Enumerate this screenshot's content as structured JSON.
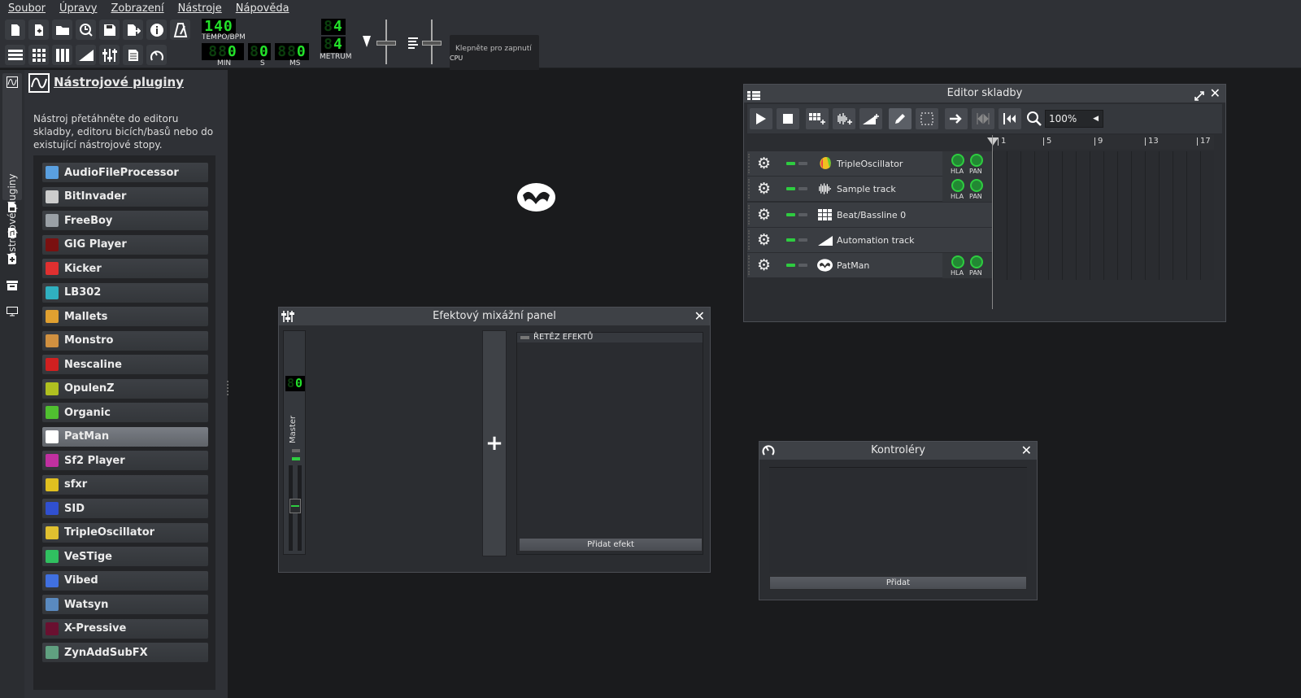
{
  "menu": [
    "Soubor",
    "Úpravy",
    "Zobrazení",
    "Nástroje",
    "Nápověda"
  ],
  "toolbar": {
    "tempo_value": "140",
    "tempo_label": "TEMPO/BPM",
    "time_min": "0",
    "time_s": "0",
    "time_ms": "0",
    "min_label": "MIN",
    "s_label": "S",
    "ms_label": "MS",
    "meter_num": "4",
    "meter_den": "4",
    "meter_label": "METRUM",
    "cpu_hint": "Klepněte pro zapnutí",
    "cpu_label": "CPU"
  },
  "sidebar": {
    "tab_label": "Nástrojové pluginy"
  },
  "browser": {
    "title": "Nástrojové pluginy",
    "description": "Nástroj přetáhněte do editoru skladby, editoru bicích/basů nebo do existující nástrojové stopy.",
    "plugins": [
      {
        "name": "AudioFileProcessor",
        "icon": "note-icon",
        "color": "#5aa0e0"
      },
      {
        "name": "BitInvader",
        "icon": "bug-icon",
        "color": "#cccccc"
      },
      {
        "name": "FreeBoy",
        "icon": "gameboy-icon",
        "color": "#9aa0a6"
      },
      {
        "name": "GIG Player",
        "icon": "gig-icon",
        "color": "#7a1010"
      },
      {
        "name": "Kicker",
        "icon": "kick-icon",
        "color": "#e03030"
      },
      {
        "name": "LB302",
        "icon": "lb302-icon",
        "color": "#30b0c0"
      },
      {
        "name": "Mallets",
        "icon": "mallets-icon",
        "color": "#e0a030"
      },
      {
        "name": "Monstro",
        "icon": "monstro-icon",
        "color": "#d09040"
      },
      {
        "name": "Nescaline",
        "icon": "nescaline-icon",
        "color": "#d02020"
      },
      {
        "name": "OpulenZ",
        "icon": "opulenz-icon",
        "color": "#b0c020"
      },
      {
        "name": "Organic",
        "icon": "organic-icon",
        "color": "#50c030"
      },
      {
        "name": "PatMan",
        "icon": "patman-icon",
        "color": "#ffffff"
      },
      {
        "name": "Sf2 Player",
        "icon": "sf2-icon",
        "color": "#c030a0"
      },
      {
        "name": "sfxr",
        "icon": "sfxr-icon",
        "color": "#e0c020"
      },
      {
        "name": "SID",
        "icon": "sid-icon",
        "color": "#3050d0"
      },
      {
        "name": "TripleOscillator",
        "icon": "triple-osc-icon",
        "color": "#e0c030"
      },
      {
        "name": "VeSTige",
        "icon": "vestige-icon",
        "color": "#30c060"
      },
      {
        "name": "Vibed",
        "icon": "vibed-icon",
        "color": "#4070e0"
      },
      {
        "name": "Watsyn",
        "icon": "watsyn-icon",
        "color": "#5a8ac0"
      },
      {
        "name": "X-Pressive",
        "icon": "xpressive-icon",
        "color": "#6a1030"
      },
      {
        "name": "ZynAddSubFX",
        "icon": "zyn-icon",
        "color": "#60a080"
      }
    ],
    "selected": "PatMan"
  },
  "song_editor": {
    "title": "Editor skladby",
    "zoom": "100%",
    "ruler": [
      "1",
      "5",
      "9",
      "13",
      "17"
    ],
    "tracks": [
      {
        "name": "TripleOscillator",
        "icon": "triple-osc-icon",
        "knobs": true
      },
      {
        "name": "Sample track",
        "icon": "waveform-icon",
        "knobs": true
      },
      {
        "name": "Beat/Bassline 0",
        "icon": "beat-grid-icon",
        "knobs": false
      },
      {
        "name": "Automation track",
        "icon": "automation-icon",
        "knobs": false
      },
      {
        "name": "PatMan",
        "icon": "patman-icon",
        "knobs": true
      }
    ],
    "knob_vol": "HLA",
    "knob_pan": "PAN"
  },
  "mixer": {
    "title": "Efektový mixážní panel",
    "channel_number": "0",
    "channel_name": "Master",
    "fx_chain_label": "ŘETĚZ EFEKTŮ",
    "add_effect": "Přidat efekt"
  },
  "controllers": {
    "title": "Kontroléry",
    "add": "Přidat"
  },
  "colors": {
    "lcd_green": "#23e02a",
    "accent_green": "#2ecc40"
  }
}
